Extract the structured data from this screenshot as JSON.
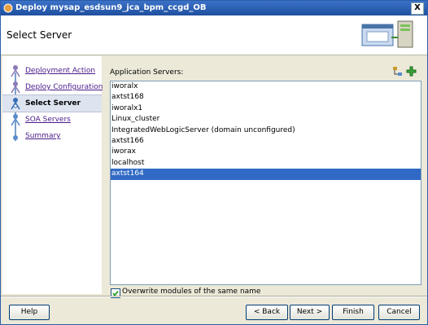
{
  "window": {
    "title": "Deploy mysap_esdsun9_jca_bpm_ccgd_OB",
    "close_glyph": "X"
  },
  "header": {
    "title": "Select Server"
  },
  "nav": {
    "items": [
      {
        "label": "Deployment Action",
        "state": "done"
      },
      {
        "label": "Deploy Configuration",
        "state": "done"
      },
      {
        "label": "Select Server",
        "state": "active"
      },
      {
        "label": "SOA Servers",
        "state": "pending"
      },
      {
        "label": "Summary",
        "state": "pending"
      }
    ]
  },
  "servers": {
    "label": "Application Servers:",
    "items": [
      "iworalx",
      "axtst168",
      "iworalx1",
      "Linux_cluster",
      "IntegratedWebLogicServer (domain unconfigured)",
      "axtst166",
      "iworax",
      "localhost",
      "axtst164"
    ],
    "selected": "axtst164"
  },
  "overwrite": {
    "label": "Overwrite modules of the same name",
    "checked": true
  },
  "buttons": {
    "help": "Help",
    "back": "< Back",
    "next": "Next >",
    "finish": "Finish",
    "cancel": "Cancel"
  },
  "colors": {
    "selection": "#316ac5",
    "titlebar": "#1f4f9f",
    "link": "#4a1a8a"
  }
}
